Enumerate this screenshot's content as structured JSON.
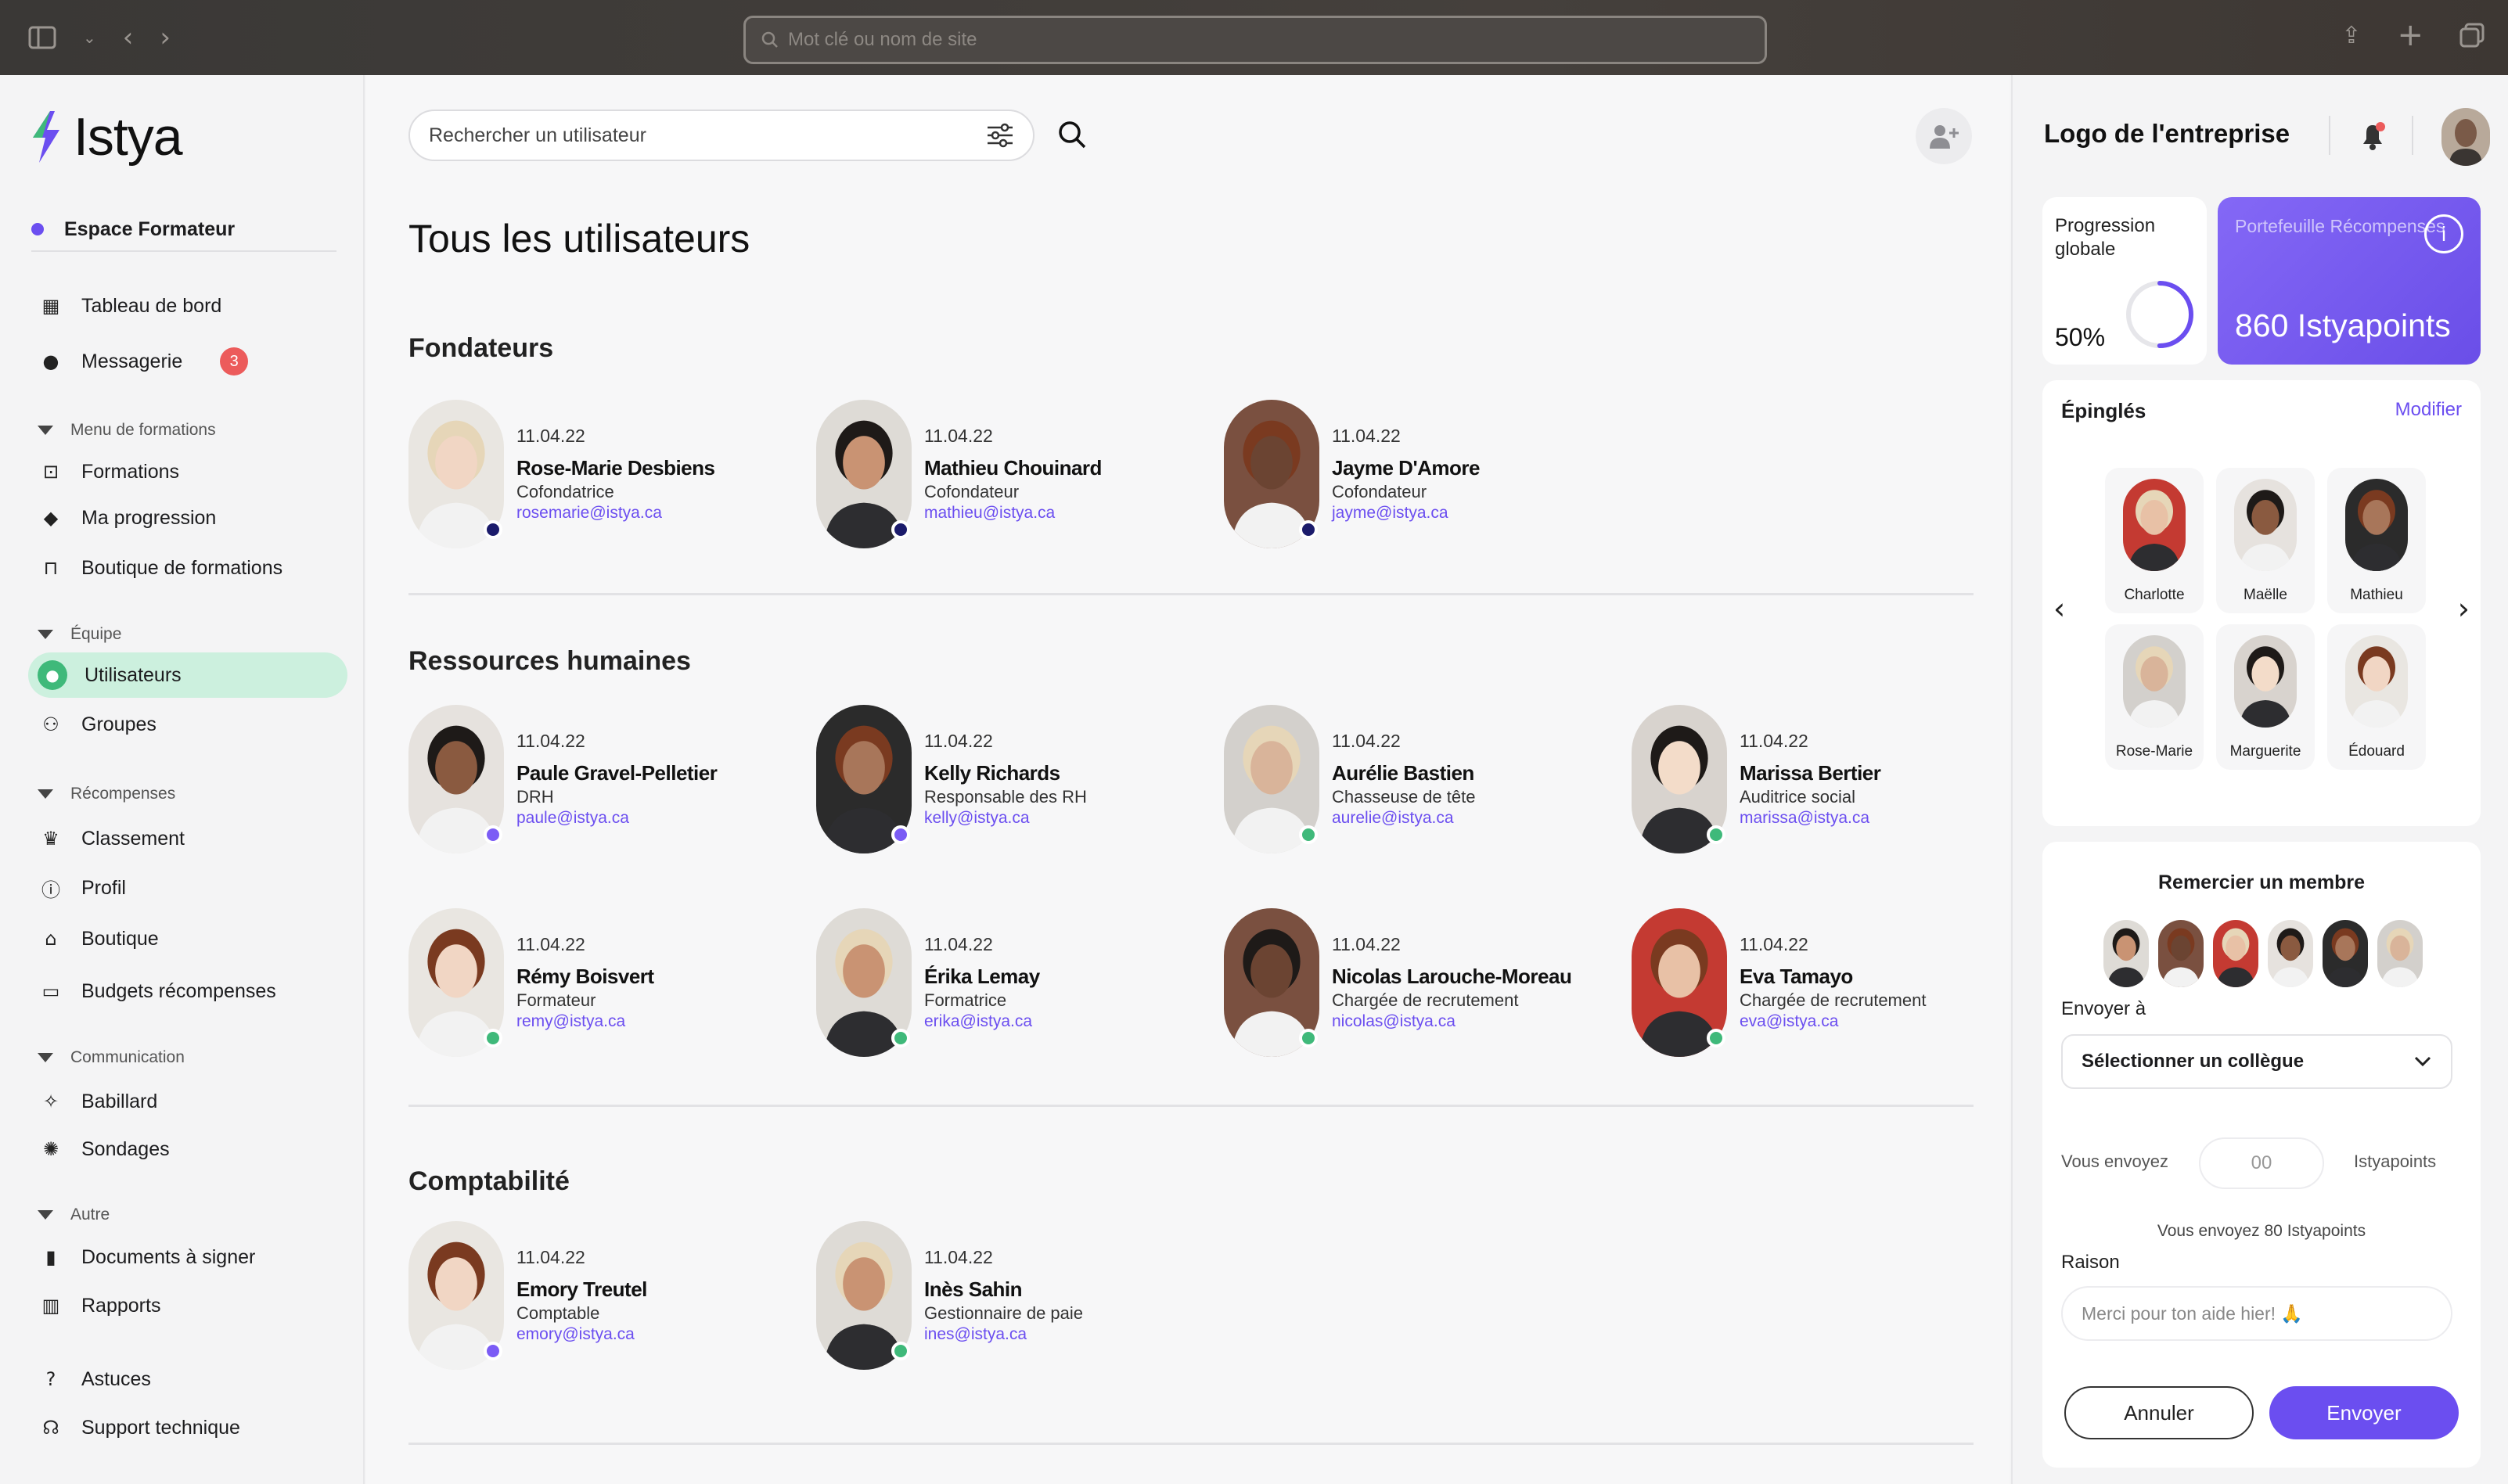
{
  "browser": {
    "address_placeholder": "Mot clé ou nom de site"
  },
  "sidebar": {
    "logo": "Istya",
    "space_label": "Espace Formateur",
    "top_items": [
      {
        "label": "Tableau de bord",
        "icon": "grid-icon"
      },
      {
        "label": "Messagerie",
        "icon": "chat-icon",
        "badge": "3"
      }
    ],
    "sections": [
      {
        "title": "Menu de formations",
        "items": [
          "Formations",
          "Ma progression",
          "Boutique de formations"
        ]
      },
      {
        "title": "Équipe",
        "items": [
          "Utilisateurs",
          "Groupes"
        ]
      },
      {
        "title": "Récompenses",
        "items": [
          "Classement",
          "Profil",
          "Boutique",
          "Budgets récompenses"
        ]
      },
      {
        "title": "Communication",
        "items": [
          "Babillard",
          "Sondages"
        ]
      },
      {
        "title": "Autre",
        "items": [
          "Documents à signer",
          "Rapports"
        ]
      }
    ],
    "bottom_items": [
      "Astuces",
      "Support technique"
    ]
  },
  "main": {
    "search_placeholder": "Rechercher un utilisateur",
    "title": "Tous les utilisateurs",
    "groups": [
      {
        "title": "Fondateurs",
        "users": [
          {
            "date": "11.04.22",
            "name": "Rose-Marie Desbiens",
            "role": "Cofondatrice",
            "email": "rosemarie@istya.ca",
            "status_color": "#1b1b6b"
          },
          {
            "date": "11.04.22",
            "name": "Mathieu Chouinard",
            "role": "Cofondateur",
            "email": "mathieu@istya.ca",
            "status_color": "#1b1b6b"
          },
          {
            "date": "11.04.22",
            "name": "Jayme D'Amore",
            "role": "Cofondateur",
            "email": "jayme@istya.ca",
            "status_color": "#1b1b6b"
          }
        ]
      },
      {
        "title": "Ressources humaines",
        "users": [
          {
            "date": "11.04.22",
            "name": "Paule Gravel-Pelletier",
            "role": "DRH",
            "email": "paule@istya.ca",
            "status_color": "#7b5cf5"
          },
          {
            "date": "11.04.22",
            "name": "Kelly Richards",
            "role": "Responsable des RH",
            "email": "kelly@istya.ca",
            "status_color": "#7b5cf5"
          },
          {
            "date": "11.04.22",
            "name": "Aurélie Bastien",
            "role": "Chasseuse de tête",
            "email": "aurelie@istya.ca",
            "status_color": "#3fb97a"
          },
          {
            "date": "11.04.22",
            "name": "Marissa Bertier",
            "role": "Auditrice social",
            "email": "marissa@istya.ca",
            "status_color": "#3fb97a"
          },
          {
            "date": "11.04.22",
            "name": "Rémy Boisvert",
            "role": "Formateur",
            "email": "remy@istya.ca",
            "status_color": "#3fb97a"
          },
          {
            "date": "11.04.22",
            "name": "Érika Lemay",
            "role": "Formatrice",
            "email": "erika@istya.ca",
            "status_color": "#3fb97a"
          },
          {
            "date": "11.04.22",
            "name": "Nicolas Larouche-Moreau",
            "role": "Chargée de recrutement",
            "email": "nicolas@istya.ca",
            "status_color": "#3fb97a"
          },
          {
            "date": "11.04.22",
            "name": "Eva Tamayo",
            "role": "Chargée de recrutement",
            "email": "eva@istya.ca",
            "status_color": "#3fb97a"
          }
        ]
      },
      {
        "title": "Comptabilité",
        "users": [
          {
            "date": "11.04.22",
            "name": "Emory Treutel",
            "role": "Comptable",
            "email": "emory@istya.ca",
            "status_color": "#7b5cf5"
          },
          {
            "date": "11.04.22",
            "name": "Inès Sahin",
            "role": "Gestionnaire de paie",
            "email": "ines@istya.ca",
            "status_color": "#3fb97a"
          }
        ]
      }
    ]
  },
  "right_panel": {
    "company_logo": "Logo de l'entreprise",
    "progress": {
      "label": "Progression globale",
      "value_text": "50%",
      "value": 0.5
    },
    "wallet": {
      "label": "Portefeuille Récompenses",
      "points": "860 Istyapoints"
    },
    "pinned": {
      "title": "Épinglés",
      "edit": "Modifier",
      "people": [
        "Charlotte",
        "Maëlle",
        "Mathieu",
        "Rose-Marie",
        "Marguerite",
        "Édouard"
      ]
    },
    "thank": {
      "title": "Remercier un membre",
      "send_to_label": "Envoyer à",
      "select_placeholder": "Sélectionner un collègue",
      "you_send_label": "Vous envoyez",
      "amount_placeholder": "00",
      "unit": "Istyapoints",
      "summary": "Vous envoyez 80 Istyapoints",
      "reason_label": "Raison",
      "reason_placeholder": "Merci pour ton aide hier! 🙏",
      "cancel": "Annuler",
      "send": "Envoyer"
    }
  },
  "colors": {
    "accent": "#6b4ef0",
    "active_nav_bg": "#ccf0de",
    "online": "#3fb97a",
    "badge": "#ec5b5b"
  }
}
